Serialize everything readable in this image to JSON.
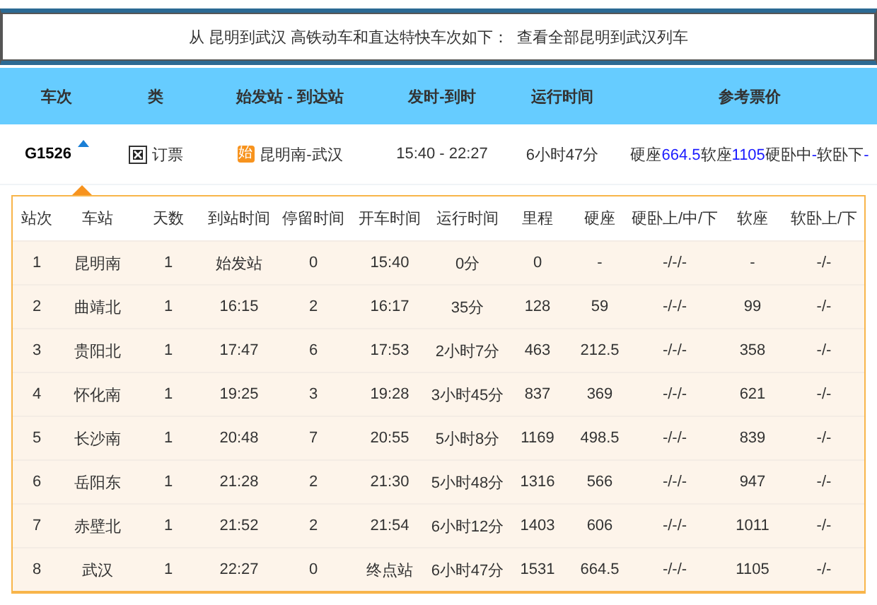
{
  "banner": {
    "prefix": "从 昆明到武汉 高铁动车和直达特快车次如下：",
    "link": "查看全部昆明到武汉列车"
  },
  "main_table": {
    "columns": [
      "车次",
      "类",
      "始发站 - 到达站",
      "发时-到时",
      "运行时间",
      "参考票价"
    ],
    "train": {
      "number": "G1526",
      "expanded": true,
      "book": "订票",
      "badge": "始",
      "route": "昆明南-武汉",
      "times": "15:40 - 22:27",
      "duration": "6小时47分",
      "prices": [
        {
          "kind": "label",
          "text": "硬座"
        },
        {
          "kind": "value",
          "text": "664.5"
        },
        {
          "kind": "label",
          "text": "软座"
        },
        {
          "kind": "value",
          "text": "1105"
        },
        {
          "kind": "label",
          "text": "硬卧中"
        },
        {
          "kind": "value",
          "text": "-"
        },
        {
          "kind": "label",
          "text": "软卧下"
        },
        {
          "kind": "value",
          "text": "-"
        }
      ]
    }
  },
  "stops_table": {
    "columns": [
      "站次",
      "车站",
      "天数",
      "到站时间",
      "停留时间",
      "开车时间",
      "运行时间",
      "里程",
      "硬座",
      "硬卧上/中/下",
      "软座",
      "软卧上/下"
    ],
    "rows": [
      [
        "1",
        "昆明南",
        "1",
        "始发站",
        "0",
        "15:40",
        "0分",
        "0",
        "-",
        "-/-/-",
        "-",
        "-/-"
      ],
      [
        "2",
        "曲靖北",
        "1",
        "16:15",
        "2",
        "16:17",
        "35分",
        "128",
        "59",
        "-/-/-",
        "99",
        "-/-"
      ],
      [
        "3",
        "贵阳北",
        "1",
        "17:47",
        "6",
        "17:53",
        "2小时7分",
        "463",
        "212.5",
        "-/-/-",
        "358",
        "-/-"
      ],
      [
        "4",
        "怀化南",
        "1",
        "19:25",
        "3",
        "19:28",
        "3小时45分",
        "837",
        "369",
        "-/-/-",
        "621",
        "-/-"
      ],
      [
        "5",
        "长沙南",
        "1",
        "20:48",
        "7",
        "20:55",
        "5小时8分",
        "1169",
        "498.5",
        "-/-/-",
        "839",
        "-/-"
      ],
      [
        "6",
        "岳阳东",
        "1",
        "21:28",
        "2",
        "21:30",
        "5小时48分",
        "1316",
        "566",
        "-/-/-",
        "947",
        "-/-"
      ],
      [
        "7",
        "赤壁北",
        "1",
        "21:52",
        "2",
        "21:54",
        "6小时12分",
        "1403",
        "606",
        "-/-/-",
        "1011",
        "-/-"
      ],
      [
        "8",
        "武汉",
        "1",
        "22:27",
        "0",
        "终点站",
        "6小时47分",
        "1531",
        "664.5",
        "-/-/-",
        "1105",
        "-/-"
      ]
    ]
  }
}
